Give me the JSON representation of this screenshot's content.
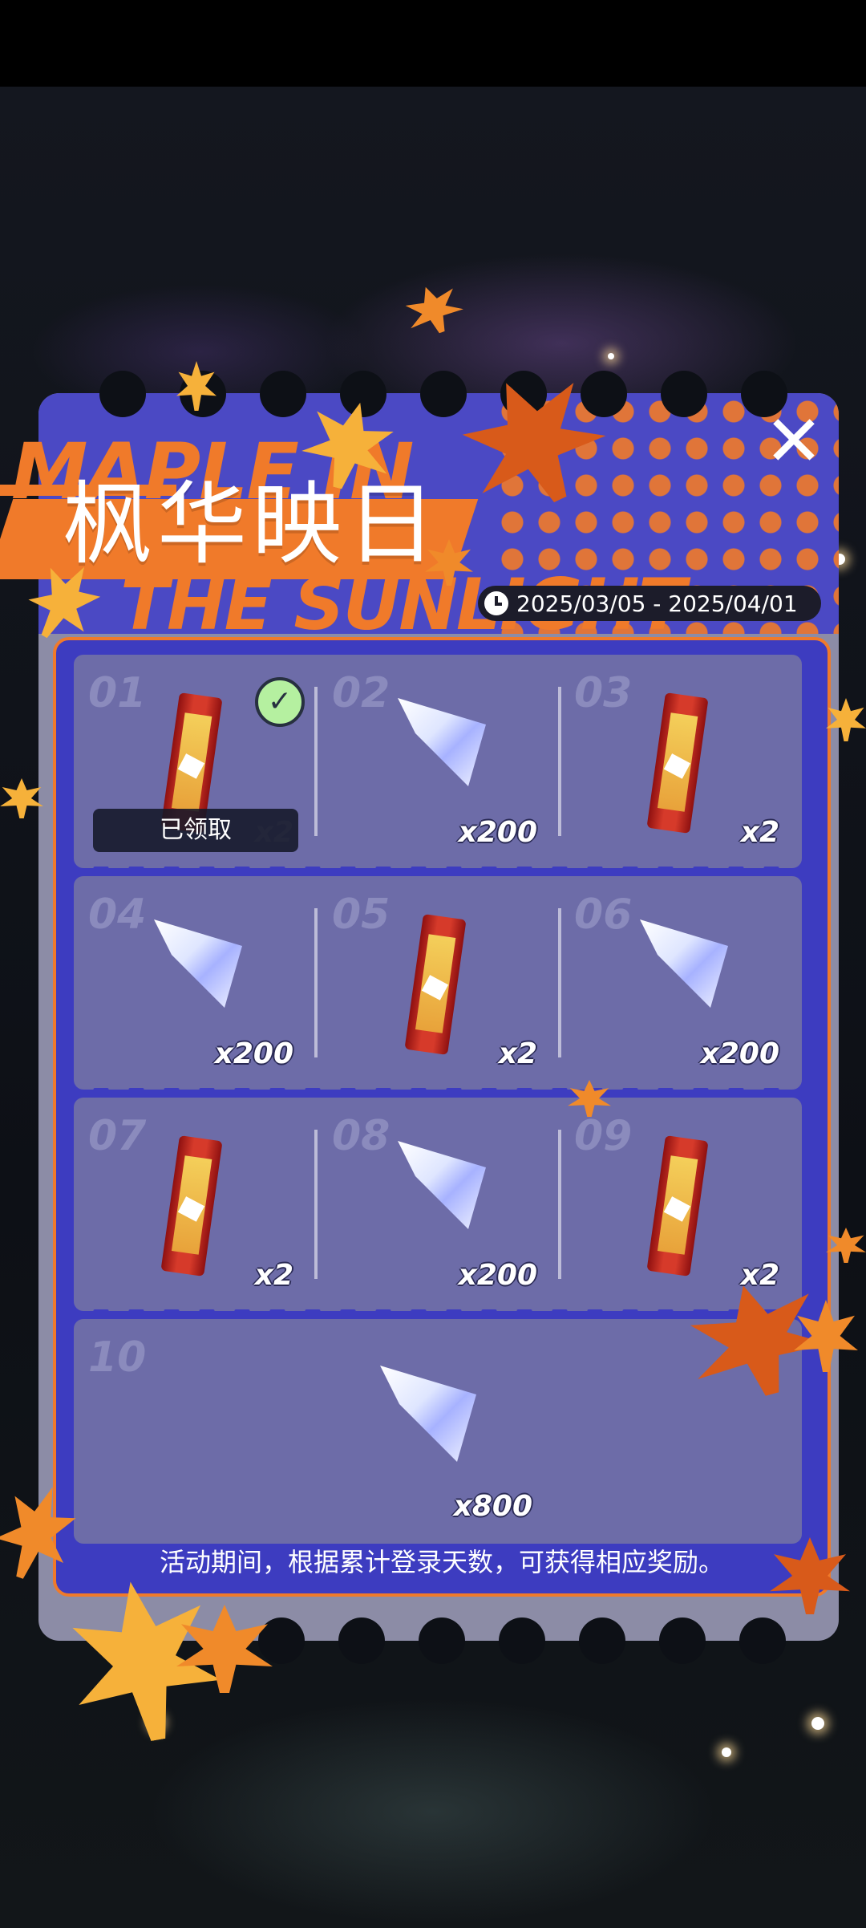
{
  "event": {
    "title_cn": "枫华映日",
    "title_en_line1": "MAPLE IN",
    "title_en_line2": "THE SUNLIGHT",
    "date_range": "2025/03/05 - 2025/04/01",
    "footer": "活动期间，根据累计登录天数，可获得相应奖励。",
    "close_icon": "close-icon"
  },
  "colors": {
    "accent_orange": "#f07a2a",
    "panel_blue": "#4b49c4",
    "cell_purple": "#6d6ca8"
  },
  "rewards": [
    {
      "day": "01",
      "item": "snack-bar",
      "qty": "x2",
      "claimed": true,
      "claimed_label": "已领取"
    },
    {
      "day": "02",
      "item": "crystal",
      "qty": "x200"
    },
    {
      "day": "03",
      "item": "snack-bar",
      "qty": "x2"
    },
    {
      "day": "04",
      "item": "crystal",
      "qty": "x200"
    },
    {
      "day": "05",
      "item": "snack-bar",
      "qty": "x2"
    },
    {
      "day": "06",
      "item": "crystal",
      "qty": "x200"
    },
    {
      "day": "07",
      "item": "snack-bar",
      "qty": "x2"
    },
    {
      "day": "08",
      "item": "crystal",
      "qty": "x200"
    },
    {
      "day": "09",
      "item": "snack-bar",
      "qty": "x2"
    },
    {
      "day": "10",
      "item": "crystal",
      "qty": "x800"
    }
  ]
}
